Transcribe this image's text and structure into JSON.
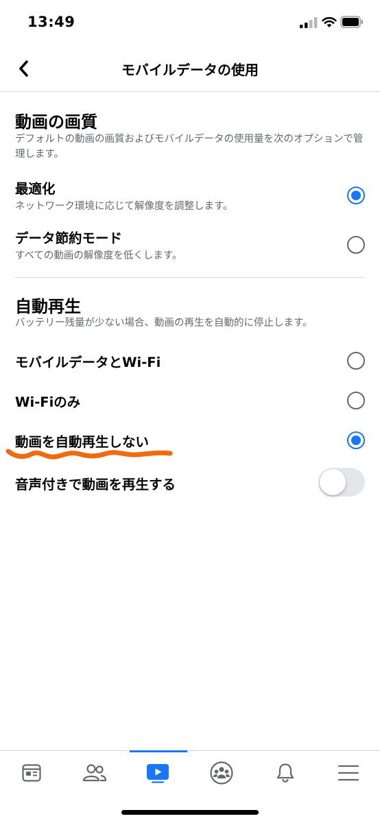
{
  "status_bar": {
    "time": "13:49"
  },
  "nav": {
    "title": "モバイルデータの使用"
  },
  "video_quality": {
    "title": "動画の画質",
    "description": "デフォルトの動画の画質およびモバイルデータの使用量を次のオプションで管理します。",
    "options": [
      {
        "label": "最適化",
        "sub": "ネットワーク環境に応じて解像度を調整します。",
        "selected": true
      },
      {
        "label": "データ節約モード",
        "sub": "すべての動画の解像度を低くします。",
        "selected": false
      }
    ]
  },
  "autoplay": {
    "title": "自動再生",
    "description": "バッテリー残量が少ない場合、動画の再生を自動的に停止します。",
    "options": [
      {
        "label": "モバイルデータとWi-Fi",
        "selected": false
      },
      {
        "label": "Wi-Fiのみ",
        "selected": false
      },
      {
        "label": "動画を自動再生しない",
        "selected": true
      }
    ],
    "sound_toggle": {
      "label": "音声付きで動画を再生する",
      "on": false
    }
  },
  "colors": {
    "accent": "#1877f2",
    "annotation": "#f26a10",
    "secondary_text": "#65676b"
  },
  "tab_bar": {
    "items": [
      {
        "icon": "news-feed-icon",
        "active": false
      },
      {
        "icon": "friends-icon",
        "active": false
      },
      {
        "icon": "watch-icon",
        "active": true
      },
      {
        "icon": "groups-icon",
        "active": false
      },
      {
        "icon": "notifications-bell-icon",
        "active": false
      },
      {
        "icon": "menu-icon",
        "active": false
      }
    ]
  }
}
